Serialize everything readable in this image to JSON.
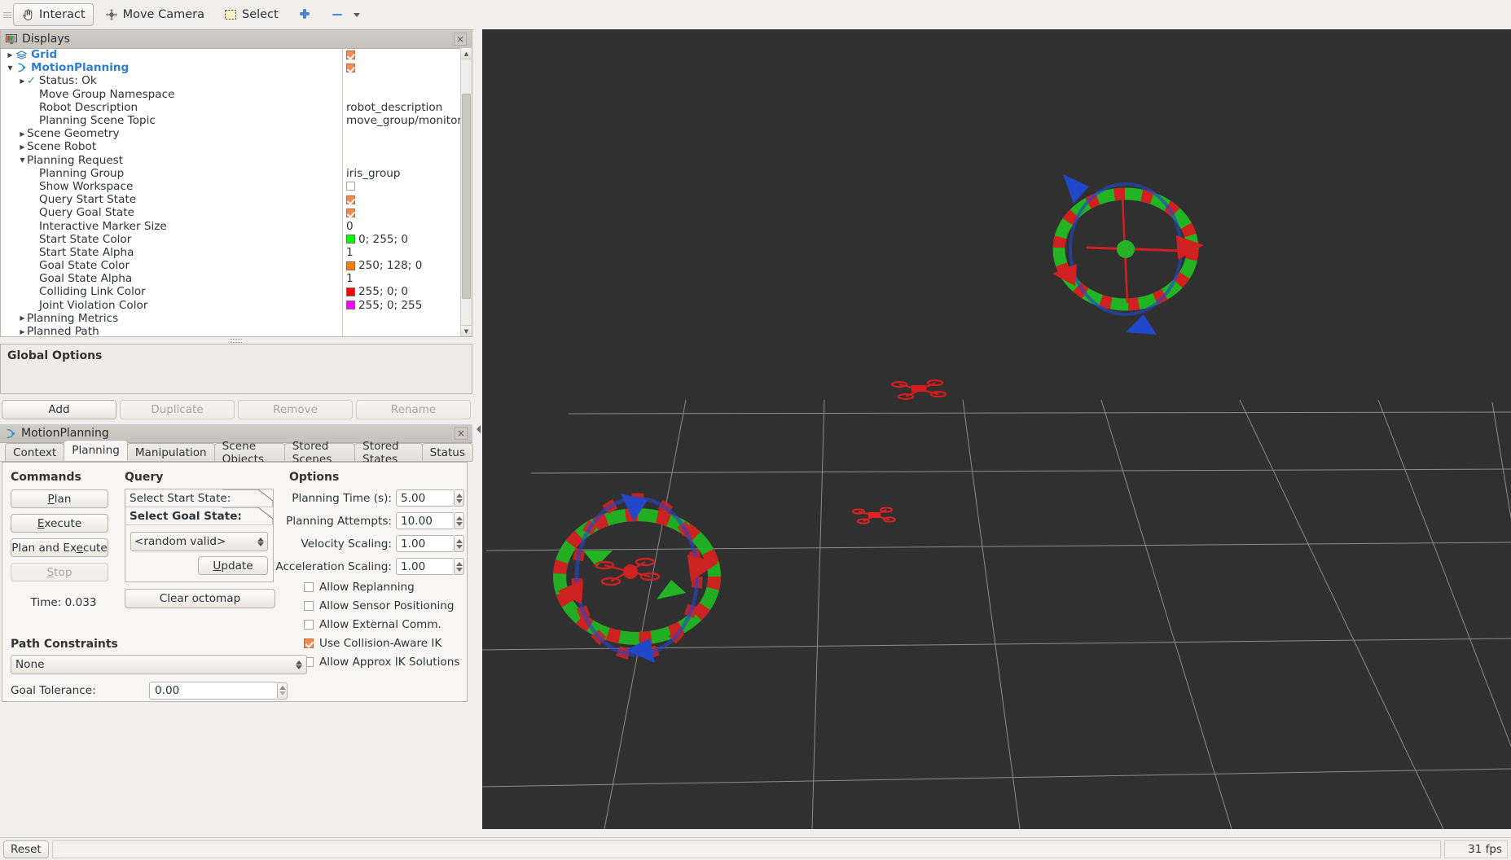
{
  "toolbar": {
    "interact_label": "Interact",
    "move_camera_label": "Move Camera",
    "select_label": "Select",
    "focus_icon": "focus-camera-icon",
    "measure_icon": "measure-icon",
    "dropdown_icon": "chevron-down-icon"
  },
  "displays_panel": {
    "title": "Displays",
    "close_label": "×",
    "tree": [
      {
        "indent": 0,
        "tri": "right",
        "label": "Grid",
        "style": "link",
        "value_type": "check",
        "checked": true
      },
      {
        "indent": 0,
        "tri": "down",
        "label": "MotionPlanning",
        "style": "link",
        "value_type": "check",
        "checked": true
      },
      {
        "indent": 1,
        "tri": "right",
        "label": "Status: Ok",
        "style": "status",
        "value_type": "none"
      },
      {
        "indent": 2,
        "tri": "none",
        "label": "Move Group Namespace",
        "style": "plain",
        "value_type": "none"
      },
      {
        "indent": 2,
        "tri": "none",
        "label": "Robot Description",
        "style": "plain",
        "value_type": "text",
        "value": "robot_description"
      },
      {
        "indent": 2,
        "tri": "none",
        "label": "Planning Scene Topic",
        "style": "plain",
        "value_type": "text",
        "value": "move_group/monitor..."
      },
      {
        "indent": 1,
        "tri": "right",
        "label": "Scene Geometry",
        "style": "plain",
        "value_type": "none"
      },
      {
        "indent": 1,
        "tri": "right",
        "label": "Scene Robot",
        "style": "plain",
        "value_type": "none"
      },
      {
        "indent": 1,
        "tri": "down",
        "label": "Planning Request",
        "style": "plain",
        "value_type": "none"
      },
      {
        "indent": 2,
        "tri": "none",
        "label": "Planning Group",
        "style": "plain",
        "value_type": "text",
        "value": "iris_group"
      },
      {
        "indent": 2,
        "tri": "none",
        "label": "Show Workspace",
        "style": "plain",
        "value_type": "check",
        "checked": false
      },
      {
        "indent": 2,
        "tri": "none",
        "label": "Query Start State",
        "style": "plain",
        "value_type": "check",
        "checked": true
      },
      {
        "indent": 2,
        "tri": "none",
        "label": "Query Goal State",
        "style": "plain",
        "value_type": "check",
        "checked": true
      },
      {
        "indent": 2,
        "tri": "none",
        "label": "Interactive Marker Size",
        "style": "plain",
        "value_type": "text",
        "value": "0"
      },
      {
        "indent": 2,
        "tri": "none",
        "label": "Start State Color",
        "style": "plain",
        "value_type": "color",
        "value": "0; 255; 0",
        "color": "#00ff00"
      },
      {
        "indent": 2,
        "tri": "none",
        "label": "Start State Alpha",
        "style": "plain",
        "value_type": "text",
        "value": "1"
      },
      {
        "indent": 2,
        "tri": "none",
        "label": "Goal State Color",
        "style": "plain",
        "value_type": "color",
        "value": "250; 128; 0",
        "color": "#fa8000"
      },
      {
        "indent": 2,
        "tri": "none",
        "label": "Goal State Alpha",
        "style": "plain",
        "value_type": "text",
        "value": "1"
      },
      {
        "indent": 2,
        "tri": "none",
        "label": "Colliding Link Color",
        "style": "plain",
        "value_type": "color",
        "value": "255; 0; 0",
        "color": "#ff0000"
      },
      {
        "indent": 2,
        "tri": "none",
        "label": "Joint Violation Color",
        "style": "plain",
        "value_type": "color",
        "value": "255; 0; 255",
        "color": "#ff00ff"
      },
      {
        "indent": 1,
        "tri": "right",
        "label": "Planning Metrics",
        "style": "plain",
        "value_type": "none"
      },
      {
        "indent": 1,
        "tri": "right",
        "label": "Planned Path",
        "style": "plain",
        "value_type": "none"
      }
    ]
  },
  "global_options": {
    "title": "Global Options"
  },
  "display_buttons": [
    {
      "label": "Add",
      "enabled": true
    },
    {
      "label": "Duplicate",
      "enabled": false
    },
    {
      "label": "Remove",
      "enabled": false
    },
    {
      "label": "Rename",
      "enabled": false
    }
  ],
  "motion_planning": {
    "title": "MotionPlanning",
    "close_label": "×",
    "tabs": [
      {
        "label": "Context",
        "selected": false
      },
      {
        "label": "Planning",
        "selected": true
      },
      {
        "label": "Manipulation",
        "selected": false
      },
      {
        "label": "Scene Objects",
        "selected": false
      },
      {
        "label": "Stored Scenes",
        "selected": false
      },
      {
        "label": "Stored States",
        "selected": false
      },
      {
        "label": "Status",
        "selected": false
      }
    ],
    "commands": {
      "title": "Commands",
      "buttons": [
        {
          "label": "Plan",
          "enabled": true
        },
        {
          "label": "Execute",
          "enabled": true
        },
        {
          "label": "Plan and Execute",
          "enabled": true
        },
        {
          "label": "Stop",
          "enabled": false
        }
      ],
      "time_label": "Time: 0.033"
    },
    "query": {
      "title": "Query",
      "start_state_label": "Select Start State:",
      "goal_state_label": "Select Goal State:",
      "goal_state_value": "<random valid>",
      "update_label": "Update",
      "clear_octomap_label": "Clear octomap"
    },
    "options": {
      "title": "Options",
      "fields": [
        {
          "label": "Planning Time (s):",
          "value": "5.00"
        },
        {
          "label": "Planning Attempts:",
          "value": "10.00"
        },
        {
          "label": "Velocity Scaling:",
          "value": "1.00"
        },
        {
          "label": "Acceleration Scaling:",
          "value": "1.00"
        }
      ],
      "checkboxes": [
        {
          "label": "Allow Replanning",
          "checked": false
        },
        {
          "label": "Allow Sensor Positioning",
          "checked": false
        },
        {
          "label": "Allow External Comm.",
          "checked": false
        },
        {
          "label": "Use Collision-Aware IK",
          "checked": true
        },
        {
          "label": "Allow Approx IK Solutions",
          "checked": false
        }
      ]
    },
    "path_constraints": {
      "title": "Path Constraints",
      "constraint_value": "None",
      "goal_tolerance_label": "Goal Tolerance:",
      "goal_tolerance_value": "0.00"
    }
  },
  "status_bar": {
    "reset_label": "Reset",
    "message": "",
    "fps": "31 fps"
  },
  "viewport": {
    "background_color": "#303030",
    "grid_color": "#9a9a9a"
  }
}
